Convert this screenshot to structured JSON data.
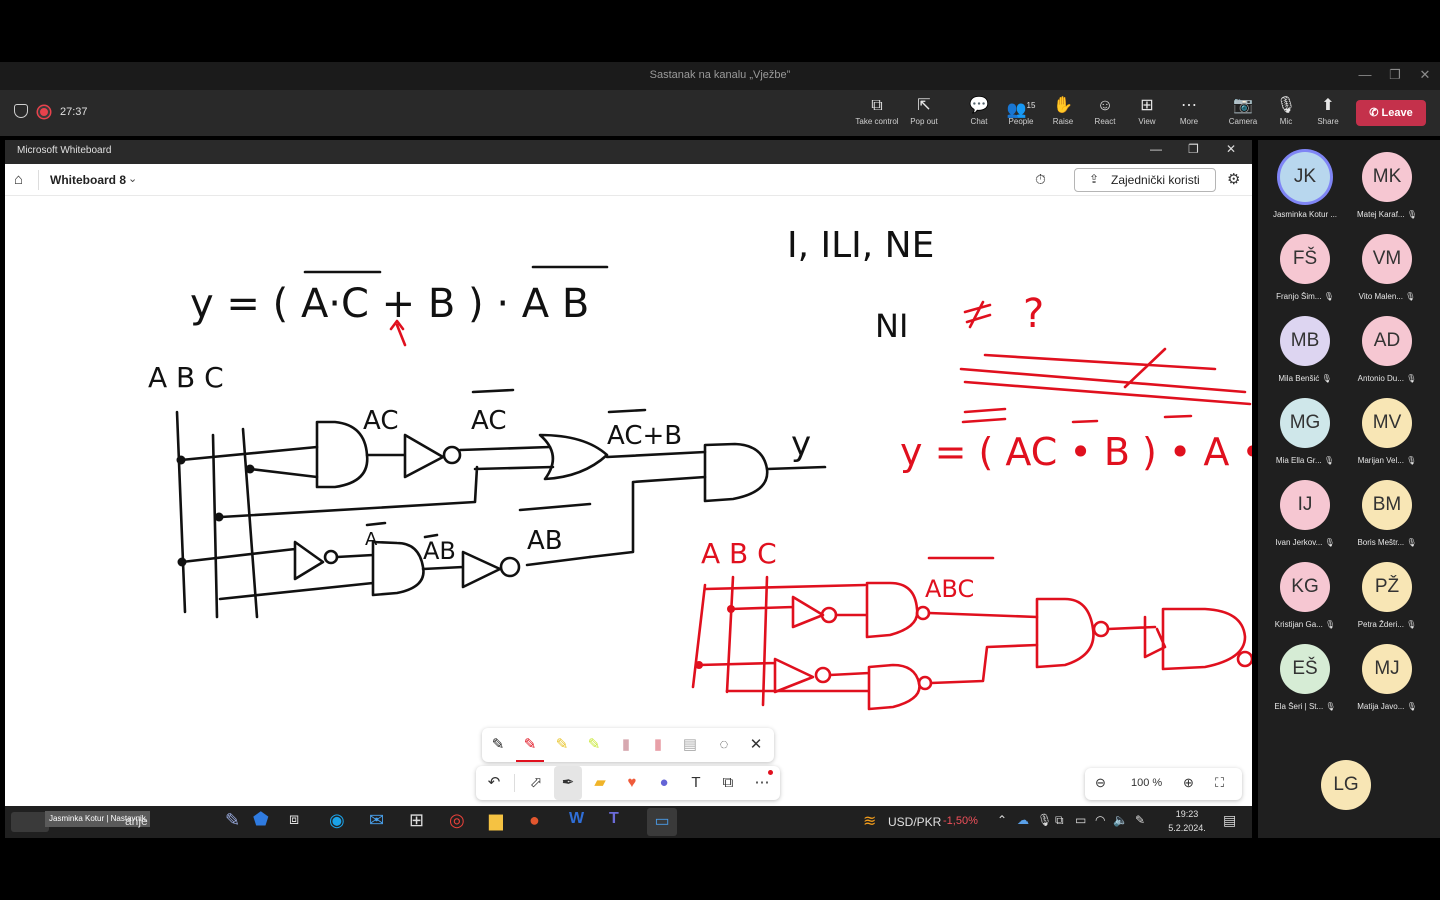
{
  "teams": {
    "window_title": "Sastanak na kanalu „Vježbe”",
    "recording_time": "27:37",
    "controls": [
      {
        "id": "take-control",
        "label": "Take control",
        "icon": "⧉"
      },
      {
        "id": "pop-out",
        "label": "Pop out",
        "icon": "⇱"
      },
      {
        "id": "chat",
        "label": "Chat",
        "icon": "💬"
      },
      {
        "id": "people",
        "label": "People",
        "icon": "👥",
        "count": "15"
      },
      {
        "id": "raise",
        "label": "Raise",
        "icon": "✋"
      },
      {
        "id": "react",
        "label": "React",
        "icon": "☺"
      },
      {
        "id": "view",
        "label": "View",
        "icon": "⊞"
      },
      {
        "id": "more",
        "label": "More",
        "icon": "⋯"
      },
      {
        "id": "camera",
        "label": "Camera",
        "icon": "📷"
      },
      {
        "id": "mic",
        "label": "Mic",
        "icon": "🎙"
      },
      {
        "id": "share",
        "label": "Share",
        "icon": "⬆"
      }
    ],
    "leave_label": "Leave",
    "accent": "#c4314b"
  },
  "whiteboard": {
    "window_title": "Microsoft Whiteboard",
    "board_name": "Whiteboard 8",
    "share_label": "Zajednički koristi",
    "zoom": "100 %",
    "handwriting": {
      "eq_main": "y = ( A·C + B ) · A B",
      "inputs_black": "A B C",
      "label_ac": "AC",
      "label_ac_bar": "AC",
      "label_ac_plus_b": "AC+B",
      "label_y_black": "y",
      "label_a": "A",
      "label_ab_bar1": "AB",
      "label_ab_bar2": "AB",
      "title_ops": "I, ILI, NE",
      "note_left": "NI",
      "note_right": "?",
      "eq_red": "y = ( AC • B ) • A • B",
      "inputs_red": "A B C",
      "label_abc": "ABC"
    }
  },
  "taskbar": {
    "active_label": "anje",
    "speaker_tag": "Jasminka Kotur | Nastavnik",
    "ticker": "USD/PKR",
    "ticker_change": "-1,50%",
    "time": "19:23",
    "date": "5.2.2024."
  },
  "participants": [
    {
      "initials": "JK",
      "name": "Jasminka Kotur ...",
      "color": "#b8d7ee",
      "muted": false,
      "active": true
    },
    {
      "initials": "MK",
      "name": "Matej Karaf...",
      "color": "#f6c7d2",
      "muted": true
    },
    {
      "initials": "FŠ",
      "name": "Franjo Šim...",
      "color": "#f6c7d2",
      "muted": true
    },
    {
      "initials": "VM",
      "name": "Vito Malen...",
      "color": "#f6c7d2",
      "muted": true
    },
    {
      "initials": "MB",
      "name": "Mila Benšić",
      "color": "#ddd5f1",
      "muted": true
    },
    {
      "initials": "AD",
      "name": "Antonio Du...",
      "color": "#f6c7d2",
      "muted": true
    },
    {
      "initials": "MG",
      "name": "Mia Ella Gr...",
      "color": "#cfe7ea",
      "muted": true
    },
    {
      "initials": "MV",
      "name": "Marijan Vel...",
      "color": "#f8e6b5",
      "muted": true
    },
    {
      "initials": "IJ",
      "name": "Ivan Jerkov...",
      "color": "#f6c7d2",
      "muted": true
    },
    {
      "initials": "BM",
      "name": "Boris Meštr...",
      "color": "#f8e6b5",
      "muted": true
    },
    {
      "initials": "KG",
      "name": "Kristijan Ga...",
      "color": "#f6c7d2",
      "muted": true
    },
    {
      "initials": "PŽ",
      "name": "Petra Žderi...",
      "color": "#f8e6b5",
      "muted": true
    },
    {
      "initials": "EŠ",
      "name": "Ela Šeri | St...",
      "color": "#d6ecd5",
      "muted": true
    },
    {
      "initials": "MJ",
      "name": "Matija Javo...",
      "color": "#f8e6b5",
      "muted": true
    },
    {
      "initials": "LG",
      "name": "",
      "color": "#f8e6b5",
      "muted": false
    }
  ]
}
